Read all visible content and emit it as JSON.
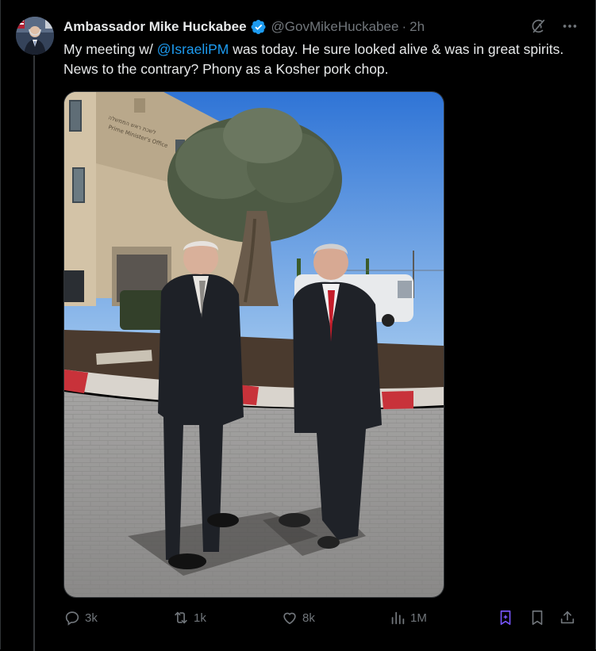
{
  "tweet": {
    "author_name": "Ambassador Mike Huckabee",
    "handle": "@GovMikeHuckabee",
    "separator": "·",
    "time": "2h",
    "text_before": "My meeting w/ ",
    "mention": "@IsraeliPM",
    "text_after": " was today.  He sure looked alive & was in great spirits.  News to the contrary? Phony as a Kosher pork chop."
  },
  "photo": {
    "building_sign_line1": "לשכת ראש הממשלה",
    "building_sign_line2": "Prime Minister's Office"
  },
  "actions": {
    "replies": "3k",
    "reposts": "1k",
    "likes": "8k",
    "views": "1M"
  },
  "icons": {
    "verified": "verified-badge-icon",
    "grok": "grok-icon",
    "more": "more-icon",
    "reply": "reply-icon",
    "repost": "repost-icon",
    "like": "like-icon",
    "views": "views-icon",
    "grok_summary": "grok-summary-icon",
    "bookmark": "bookmark-icon",
    "share": "share-icon"
  },
  "colors": {
    "background": "#000000",
    "text": "#e7e9ea",
    "secondary": "#71767b",
    "link": "#1d9bf0",
    "verified": "#1d9bf0",
    "grok_accent": "#7856ff"
  }
}
